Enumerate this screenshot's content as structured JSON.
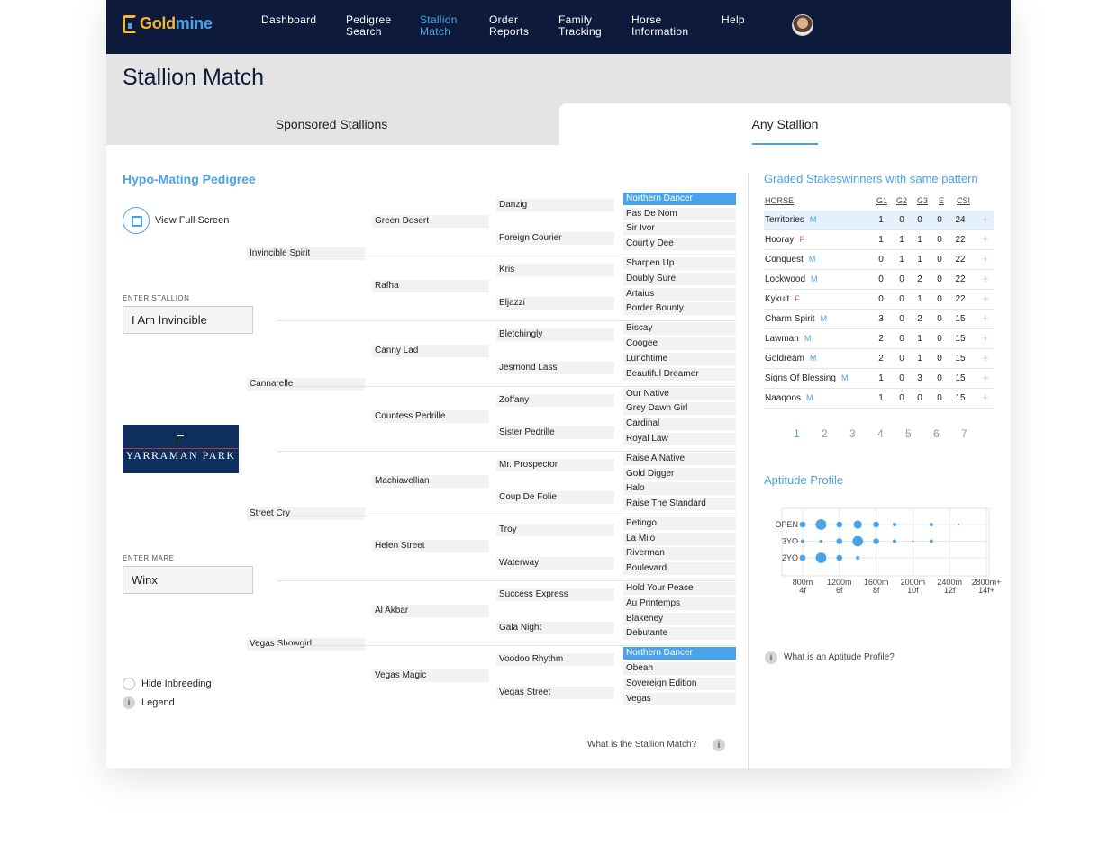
{
  "nav": {
    "logo_a": "Gold",
    "logo_b": "mine",
    "items": [
      {
        "line1": "Dashboard",
        "line2": ""
      },
      {
        "line1": "Pedigree",
        "line2": "Search"
      },
      {
        "line1": "Stallion",
        "line2": "Match"
      },
      {
        "line1": "Order",
        "line2": "Reports"
      },
      {
        "line1": "Family",
        "line2": "Tracking"
      },
      {
        "line1": "Horse",
        "line2": "Information"
      },
      {
        "line1": "Help",
        "line2": ""
      }
    ]
  },
  "page": {
    "title": "Stallion Match"
  },
  "tabs": {
    "sponsored": "Sponsored Stallions",
    "any": "Any Stallion"
  },
  "left": {
    "section_title": "Hypo-Mating Pedigree",
    "view_full_screen": "View Full Screen",
    "stallion_label": "ENTER STALLION",
    "stallion_value": "I Am Invincible",
    "mare_label": "ENTER MARE",
    "mare_value": "Winx",
    "sponsor_logo": "YARRAMAN PARK",
    "hide_inbreeding": "Hide Inbreeding",
    "legend": "Legend",
    "info_glyph": "i"
  },
  "pedigree": {
    "gen1": [
      "Invincible Spirit",
      "Cannarelle",
      "Street Cry",
      "Vegas Showgirl"
    ],
    "gen2": [
      "Green Desert",
      "Rafha",
      "Canny Lad",
      "Countess Pedrille",
      "Machiavellian",
      "Helen Street",
      "Al Akbar",
      "Vegas Magic"
    ],
    "gen3": [
      "Danzig",
      "Foreign Courier",
      "Kris",
      "Eljazzi",
      "Bletchingly",
      "Jesmond Lass",
      "Zoffany",
      "Sister Pedrille",
      "Mr. Prospector",
      "Coup De Folie",
      "Troy",
      "Waterway",
      "Success Express",
      "Gala Night",
      "Voodoo Rhythm",
      "Vegas Street"
    ],
    "gen4": [
      "Northern Dancer",
      "Pas De Nom",
      "Sir Ivor",
      "Courtly Dee",
      "Sharpen Up",
      "Doubly Sure",
      "Artaius",
      "Border Bounty",
      "Biscay",
      "Coogee",
      "Lunchtime",
      "Beautiful Dreamer",
      "Our Native",
      "Grey Dawn Girl",
      "Cardinal",
      "Royal Law",
      "Raise A Native",
      "Gold Digger",
      "Halo",
      "Raise The Standard",
      "Petingo",
      "La Milo",
      "Riverman",
      "Boulevard",
      "Hold Your Peace",
      "Au Printemps",
      "Blakeney",
      "Debutante",
      "Northern Dancer",
      "Obeah",
      "Sovereign Edition",
      "Vegas"
    ],
    "highlighted_gen4": [
      0,
      28
    ],
    "question": "What is the Stallion Match?"
  },
  "stakes": {
    "title": "Graded Stakeswinners with same pattern",
    "headers": {
      "horse": "HORSE",
      "g1": "G1",
      "g2": "G2",
      "g3": "G3",
      "e": "E",
      "csi": "CSI"
    },
    "rows": [
      {
        "name": "Territories",
        "sex": "M",
        "g1": "1",
        "g2": "0",
        "g3": "0",
        "e": "0",
        "csi": "24",
        "highlight": true
      },
      {
        "name": "Hooray",
        "sex": "F",
        "g1": "1",
        "g2": "1",
        "g3": "1",
        "e": "0",
        "csi": "22"
      },
      {
        "name": "Conquest",
        "sex": "M",
        "g1": "0",
        "g2": "1",
        "g3": "1",
        "e": "0",
        "csi": "22"
      },
      {
        "name": "Lockwood",
        "sex": "M",
        "g1": "0",
        "g2": "0",
        "g3": "2",
        "e": "0",
        "csi": "22"
      },
      {
        "name": "Kykuit",
        "sex": "F",
        "g1": "0",
        "g2": "0",
        "g3": "1",
        "e": "0",
        "csi": "22"
      },
      {
        "name": "Charm Spirit",
        "sex": "M",
        "g1": "3",
        "g2": "0",
        "g3": "2",
        "e": "0",
        "csi": "15"
      },
      {
        "name": "Lawman",
        "sex": "M",
        "g1": "2",
        "g2": "0",
        "g3": "1",
        "e": "0",
        "csi": "15"
      },
      {
        "name": "Goldream",
        "sex": "M",
        "g1": "2",
        "g2": "0",
        "g3": "1",
        "e": "0",
        "csi": "15"
      },
      {
        "name": "Signs Of Blessing",
        "sex": "M",
        "g1": "1",
        "g2": "0",
        "g3": "3",
        "e": "0",
        "csi": "15"
      },
      {
        "name": "Naaqoos",
        "sex": "M",
        "g1": "1",
        "g2": "0",
        "g3": "0",
        "e": "0",
        "csi": "15"
      }
    ],
    "plus_glyph": "+",
    "pages": [
      "1",
      "2",
      "3",
      "4",
      "5",
      "6",
      "7"
    ],
    "active_page": "1"
  },
  "aptitude": {
    "title": "Aptitude Profile",
    "question": "What is an Aptitude Profile?"
  },
  "chart_data": {
    "type": "scatter",
    "categories_y": [
      "OPEN",
      "3YO",
      "2YO"
    ],
    "x_ticks": [
      {
        "line1": "800m",
        "line2": "4f"
      },
      {
        "line1": "1200m",
        "line2": "6f"
      },
      {
        "line1": "1600m",
        "line2": "8f"
      },
      {
        "line1": "2000m",
        "line2": "10f"
      },
      {
        "line1": "2400m",
        "line2": "12f"
      },
      {
        "line1": "2800m+",
        "line2": "14f+"
      }
    ],
    "points": [
      {
        "cat": "OPEN",
        "dist": 800,
        "size": 2
      },
      {
        "cat": "OPEN",
        "dist": 1000,
        "size": 4
      },
      {
        "cat": "OPEN",
        "dist": 1200,
        "size": 2
      },
      {
        "cat": "OPEN",
        "dist": 1400,
        "size": 3
      },
      {
        "cat": "OPEN",
        "dist": 1600,
        "size": 2
      },
      {
        "cat": "OPEN",
        "dist": 1800,
        "size": 1
      },
      {
        "cat": "OPEN",
        "dist": 2200,
        "size": 1
      },
      {
        "cat": "OPEN",
        "dist": 2500,
        "size": 0.3
      },
      {
        "cat": "3YO",
        "dist": 800,
        "size": 1
      },
      {
        "cat": "3YO",
        "dist": 1000,
        "size": 0.8
      },
      {
        "cat": "3YO",
        "dist": 1200,
        "size": 2
      },
      {
        "cat": "3YO",
        "dist": 1400,
        "size": 4
      },
      {
        "cat": "3YO",
        "dist": 1600,
        "size": 2
      },
      {
        "cat": "3YO",
        "dist": 1800,
        "size": 1
      },
      {
        "cat": "3YO",
        "dist": 2000,
        "size": 0.3
      },
      {
        "cat": "3YO",
        "dist": 2200,
        "size": 1
      },
      {
        "cat": "2YO",
        "dist": 800,
        "size": 2
      },
      {
        "cat": "2YO",
        "dist": 1000,
        "size": 4
      },
      {
        "cat": "2YO",
        "dist": 1200,
        "size": 2
      },
      {
        "cat": "2YO",
        "dist": 1400,
        "size": 1
      }
    ],
    "color": "#4aa3e8",
    "grid": true
  }
}
